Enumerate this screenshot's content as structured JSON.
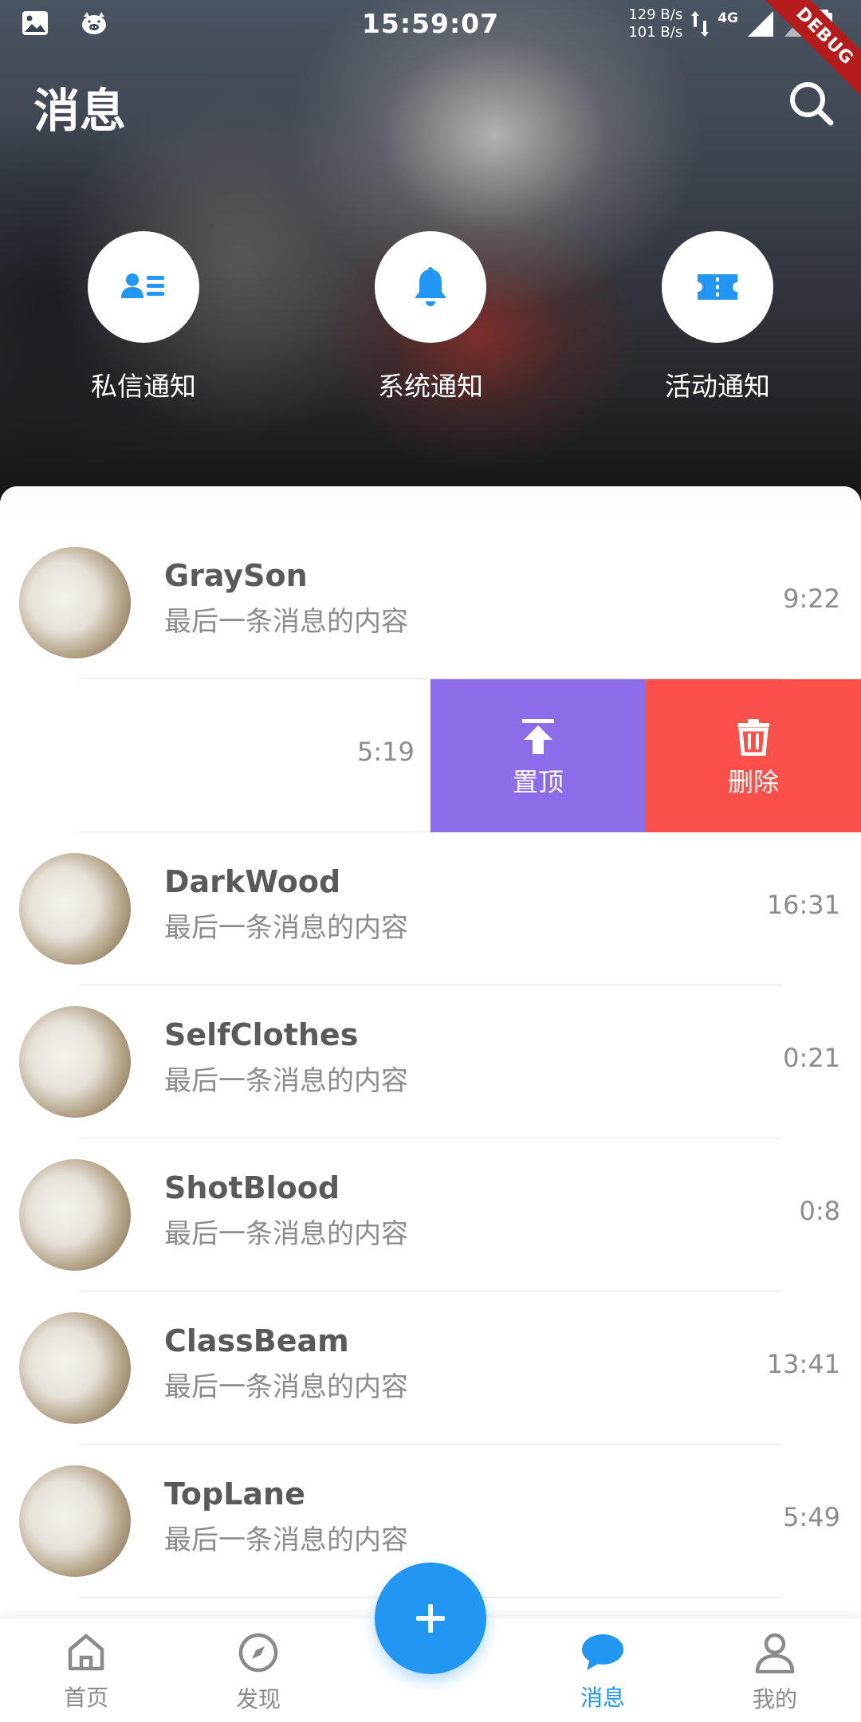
{
  "status_bar": {
    "time": "15:59:07",
    "upload_speed": "129 B/s",
    "download_speed": "101 B/s",
    "network_type": "4G",
    "debug_label": "DEBUG"
  },
  "header": {
    "title": "消息"
  },
  "quick_actions": [
    {
      "label": "私信通知",
      "icon": "contact-card-icon"
    },
    {
      "label": "系统通知",
      "icon": "bell-icon"
    },
    {
      "label": "活动通知",
      "icon": "ticket-icon"
    }
  ],
  "conversations": [
    {
      "name": "GraySon",
      "preview": "最后一条消息的内容",
      "time": "9:22"
    },
    {
      "name": "",
      "preview": "",
      "time": "5:19",
      "swiped": true
    },
    {
      "name": "DarkWood",
      "preview": "最后一条消息的内容",
      "time": "16:31"
    },
    {
      "name": "SelfClothes",
      "preview": "最后一条消息的内容",
      "time": "0:21"
    },
    {
      "name": "ShotBlood",
      "preview": "最后一条消息的内容",
      "time": "0:8"
    },
    {
      "name": "ClassBeam",
      "preview": "最后一条消息的内容",
      "time": "13:41"
    },
    {
      "name": "TopLane",
      "preview": "最后一条消息的内容",
      "time": "5:49"
    }
  ],
  "swipe_actions": {
    "pin_label": "置顶",
    "delete_label": "删除"
  },
  "colors": {
    "accent": "#2196f3",
    "pin": "#8c6ce8",
    "delete": "#fb4f49"
  },
  "bottom_nav": {
    "items": [
      {
        "label": "首页",
        "icon": "home-icon"
      },
      {
        "label": "发现",
        "icon": "compass-icon"
      },
      {
        "label": "消息",
        "icon": "chat-bubble-icon",
        "active": true
      },
      {
        "label": "我的",
        "icon": "person-icon"
      }
    ],
    "fab_icon": "plus-icon"
  }
}
